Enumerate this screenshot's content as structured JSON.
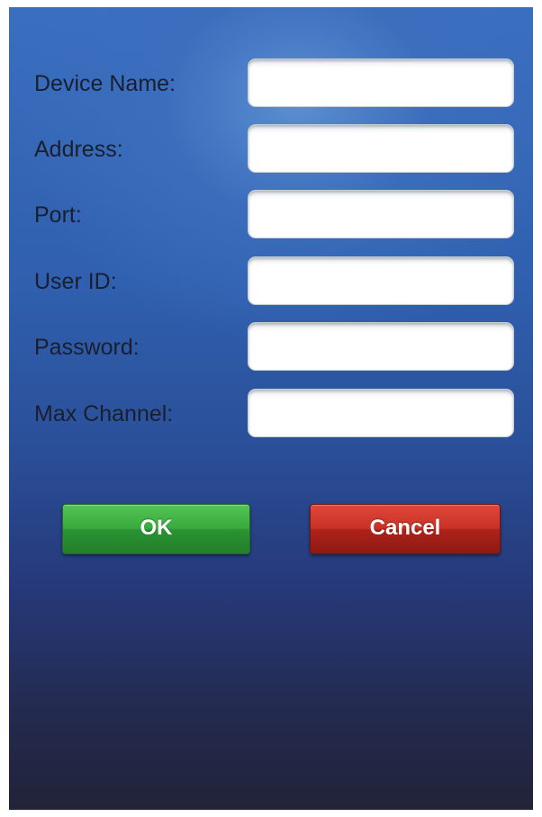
{
  "form": {
    "fields": [
      {
        "label": "Device Name:",
        "value": ""
      },
      {
        "label": "Address:",
        "value": ""
      },
      {
        "label": "Port:",
        "value": ""
      },
      {
        "label": "User ID:",
        "value": ""
      },
      {
        "label": "Password:",
        "value": ""
      },
      {
        "label": "Max Channel:",
        "value": ""
      }
    ]
  },
  "buttons": {
    "ok_label": "OK",
    "cancel_label": "Cancel"
  },
  "colors": {
    "background_top": "#3a6fbf",
    "background_bottom": "#222338",
    "ok_button": "#38aa3e",
    "cancel_button": "#c83226",
    "label_text": "#1a1f2e"
  }
}
